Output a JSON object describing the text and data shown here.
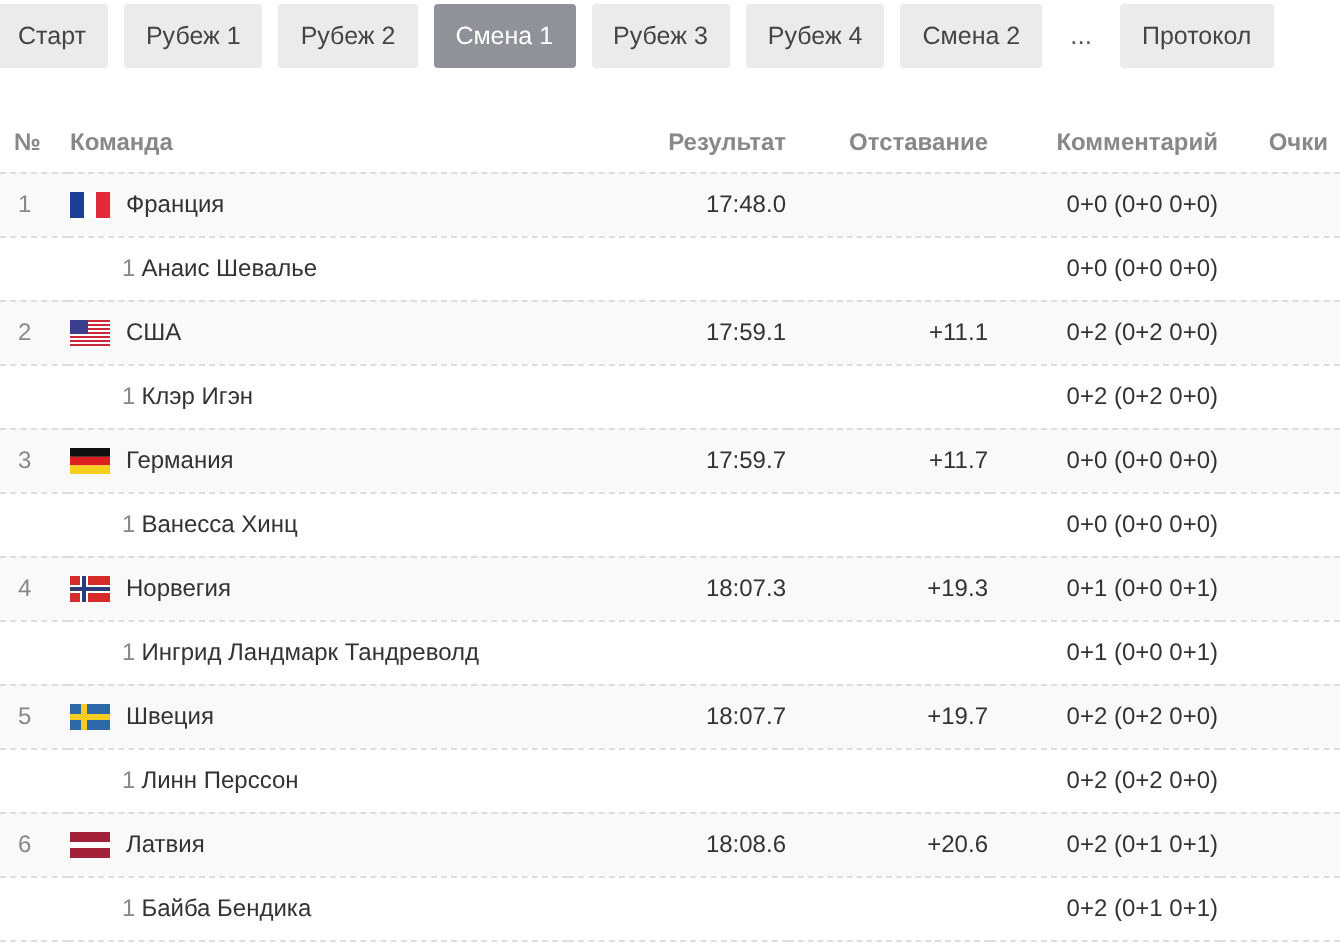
{
  "tabs": [
    {
      "kind": "button",
      "label": "Старт",
      "selected": false
    },
    {
      "kind": "button",
      "label": "Рубеж 1",
      "selected": false
    },
    {
      "kind": "button",
      "label": "Рубеж 2",
      "selected": false
    },
    {
      "kind": "button",
      "label": "Смена 1",
      "selected": true
    },
    {
      "kind": "button",
      "label": "Рубеж 3",
      "selected": false
    },
    {
      "kind": "button",
      "label": "Рубеж 4",
      "selected": false
    },
    {
      "kind": "button",
      "label": "Смена 2",
      "selected": false
    },
    {
      "kind": "ellipsis",
      "label": "..."
    },
    {
      "kind": "button",
      "label": "Протокол",
      "selected": false
    }
  ],
  "table": {
    "columns": [
      "№",
      "Команда",
      "Результат",
      "Отставание",
      "Комментарий",
      "Очки"
    ],
    "rows": [
      {
        "rank": "1",
        "kind": "fr",
        "team": "Франция",
        "result": "17:48.0",
        "comment": "0+0 (0+0 0+0)",
        "members": [
          {
            "leg": "1",
            "name": "Анаис Шевалье",
            "comment": "0+0 (0+0 0+0)"
          }
        ]
      },
      {
        "rank": "2",
        "kind": "us",
        "team": "США",
        "result": "17:59.1",
        "behind": "+11.1",
        "comment": "0+2 (0+2 0+0)",
        "members": [
          {
            "leg": "1",
            "name": "Клэр Игэн",
            "comment": "0+2 (0+2 0+0)"
          }
        ]
      },
      {
        "rank": "3",
        "kind": "de",
        "team": "Германия",
        "result": "17:59.7",
        "behind": "+11.7",
        "comment": "0+0 (0+0 0+0)",
        "members": [
          {
            "leg": "1",
            "name": "Ванесса Хинц",
            "comment": "0+0 (0+0 0+0)"
          }
        ]
      },
      {
        "rank": "4",
        "kind": "no",
        "team": "Норвегия",
        "result": "18:07.3",
        "behind": "+19.3",
        "comment": "0+1 (0+0 0+1)",
        "members": [
          {
            "leg": "1",
            "name": "Ингрид Ландмарк Тандреволд",
            "comment": "0+1 (0+0 0+1)"
          }
        ]
      },
      {
        "rank": "5",
        "kind": "se",
        "team": "Швеция",
        "result": "18:07.7",
        "behind": "+19.7",
        "comment": "0+2 (0+2 0+0)",
        "members": [
          {
            "leg": "1",
            "name": "Линн Перссон",
            "comment": "0+2 (0+2 0+0)"
          }
        ]
      },
      {
        "rank": "6",
        "kind": "lv",
        "team": "Латвия",
        "result": "18:08.6",
        "behind": "+20.6",
        "comment": "0+2 (0+1 0+1)",
        "members": [
          {
            "leg": "1",
            "name": "Байба Бендика",
            "comment": "0+2 (0+1 0+1)"
          }
        ]
      }
    ]
  }
}
